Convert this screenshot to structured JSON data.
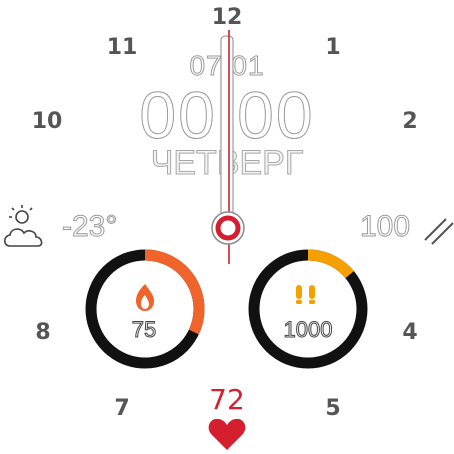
{
  "dial": {
    "hours": [
      "12",
      "1",
      "2",
      "4",
      "5",
      "7",
      "8",
      "10",
      "11"
    ]
  },
  "date": "07/01",
  "time": "00:00",
  "weekday": "ЧЕТВЕРГ",
  "weather": {
    "icon": "partly-cloudy-icon",
    "temperature": "-23°"
  },
  "battery": {
    "value": "100",
    "icon": "battery-slash-icon"
  },
  "calories": {
    "value": "75",
    "icon": "flame-icon",
    "progress": 0.32,
    "color": "#f0632b"
  },
  "steps": {
    "value": "1000",
    "icon": "footprints-icon",
    "progress": 0.14,
    "color": "#f5a000"
  },
  "heart_rate": {
    "value": "72",
    "icon": "heart-icon",
    "color": "#d41f2f"
  },
  "colors": {
    "accent": "#d41f2f",
    "numerals": "#555555",
    "ring": "#111111"
  }
}
